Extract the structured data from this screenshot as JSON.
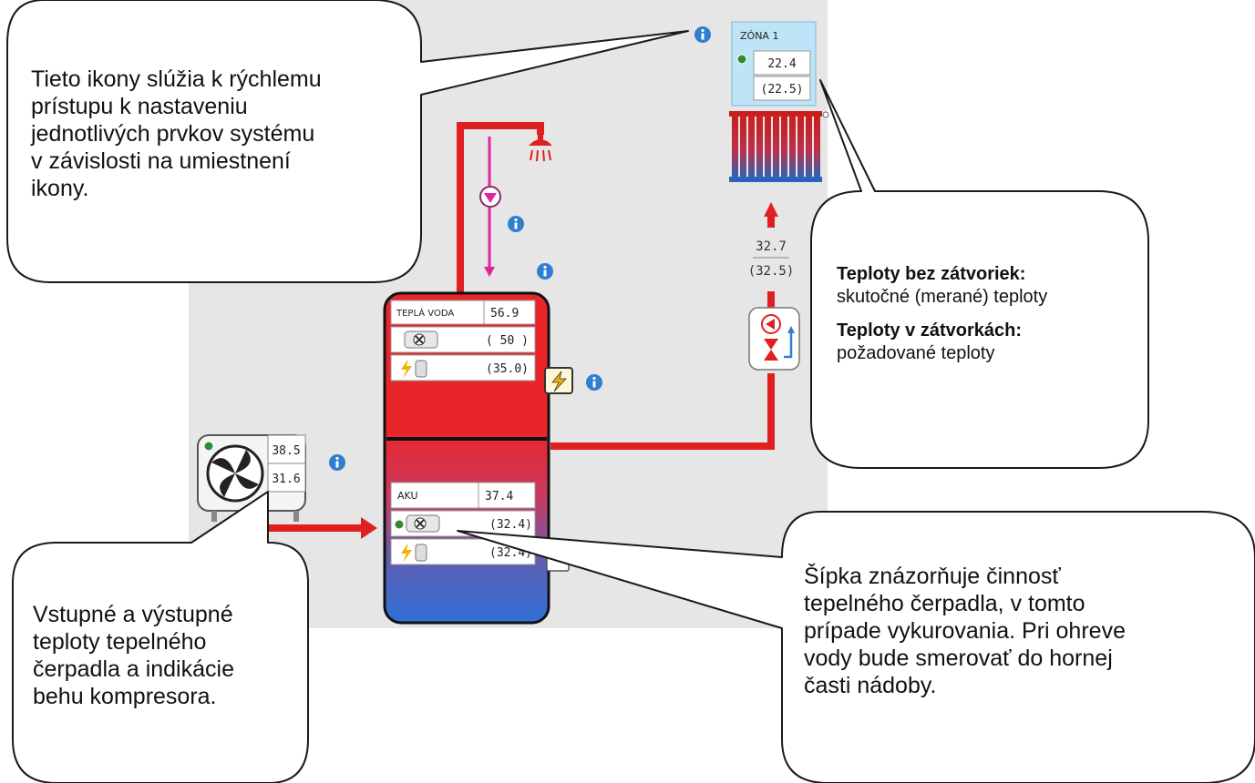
{
  "zone": {
    "title": "ZÓNA 1",
    "actual": "22.4",
    "required": "(22.5)"
  },
  "heating_circuit": {
    "actual": "32.7",
    "required": "(32.5)"
  },
  "hot_water": {
    "label": "TEPLÁ VODA",
    "actual": "56.9",
    "heat_pump_required": "( 50 )",
    "electric_required": "(35.0)"
  },
  "accumulation": {
    "label": "AKU",
    "actual": "37.4",
    "heat_pump_required": "(32.4)",
    "electric_required": "(32.4)"
  },
  "heat_pump": {
    "inlet": "38.5",
    "outlet": "31.6"
  },
  "callouts": {
    "icons": [
      "Tieto ikony slúžia k rýchlemu",
      "prístupu k nastaveniu",
      "jednotlivých prvkov systému",
      "v závislosti na umiestnení",
      "ikony."
    ],
    "temps_actual_title": "Teploty bez zátvoriek:",
    "temps_actual_text": "skutočné (merané) teploty",
    "temps_required_title": "Teploty v zátvorkách:",
    "temps_required_text": "požadované teploty",
    "heat_pump": [
      "Vstupné a výstupné",
      "teploty tepelného",
      "čerpadla a indikácie",
      "behu kompresora."
    ],
    "arrow": [
      "Šípka znázorňuje činnosť",
      "tepelného čerpadla, v tomto",
      "prípade vykurovania. Pri ohreve",
      "vody bude smerovať do hornej",
      "časti nádoby."
    ]
  },
  "colors": {
    "background_panel": "#e6e6e6",
    "hot_pipe": "#e02020",
    "info_icon": "#2f7fd0",
    "zone_header": "#bfe3f7",
    "status_led": "#2e8b3a",
    "flow_arrow": "#e0249a"
  }
}
